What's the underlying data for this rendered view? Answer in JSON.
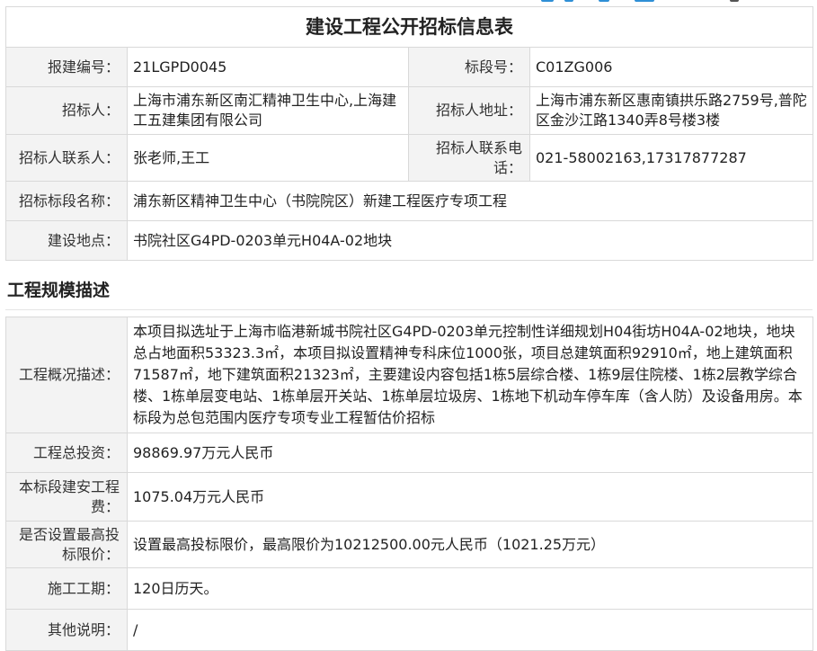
{
  "header": {
    "title": "建设工程公开招标信息表"
  },
  "info_rows": [
    {
      "label": "报建编号：",
      "value": "21LGPD0045"
    },
    {
      "label": "标段号：",
      "value": "C01ZG006"
    },
    {
      "label": "招标人：",
      "value": "上海市浦东新区南汇精神卫生中心,上海建工五建集团有限公司"
    },
    {
      "label": "招标人地址：",
      "value": "上海市浦东新区惠南镇拱乐路2759号,普陀区金沙江路1340弄8号楼3楼"
    },
    {
      "label": "招标人联系人：",
      "value": "张老师,王工"
    },
    {
      "label": "招标人联系电话：",
      "value": "021-58002163,17317877287"
    },
    {
      "label": "招标标段名称：",
      "value": "浦东新区精神卫生中心（书院院区）新建工程医疗专项工程"
    },
    {
      "label": "建设地点：",
      "value": "书院社区G4PD-0203单元H04A-02地块"
    }
  ],
  "section": {
    "heading": "工程规模描述"
  },
  "scale_rows": [
    {
      "label": "工程概况描述：",
      "value": "本项目拟选址于上海市临港新城书院社区G4PD-0203单元控制性详细规划H04街坊H04A-02地块，地块总占地面积53323.3㎡，本项目拟设置精神专科床位1000张，项目总建筑面积92910㎡，地上建筑面积71587㎡，地下建筑面积21323㎡，主要建设内容包括1栋5层综合楼、1栋9层住院楼、1栋2层教学综合楼、1栋单层变电站、1栋单层开关站、1栋单层垃圾房、1栋地下机动车停车库（含人防）及设备用房。本标段为总包范围内医疗专项专业工程暂估价招标"
    },
    {
      "label": "工程总投资：",
      "value": "98869.97万元人民币"
    },
    {
      "label": "本标段建安工程费：",
      "value": "1075.04万元人民币"
    },
    {
      "label": "是否设置最高投标限价：",
      "value": "设置最高投标限价，最高限价为10212500.00元人民币（1021.25万元）"
    },
    {
      "label": "施工工期：",
      "value": "120日历天。"
    },
    {
      "label": "其他说明：",
      "value": "/"
    }
  ],
  "colors": {
    "label_bg": "#f3f3f3",
    "border": "#d9d9d9",
    "top_accent": "#2f8fd6"
  }
}
